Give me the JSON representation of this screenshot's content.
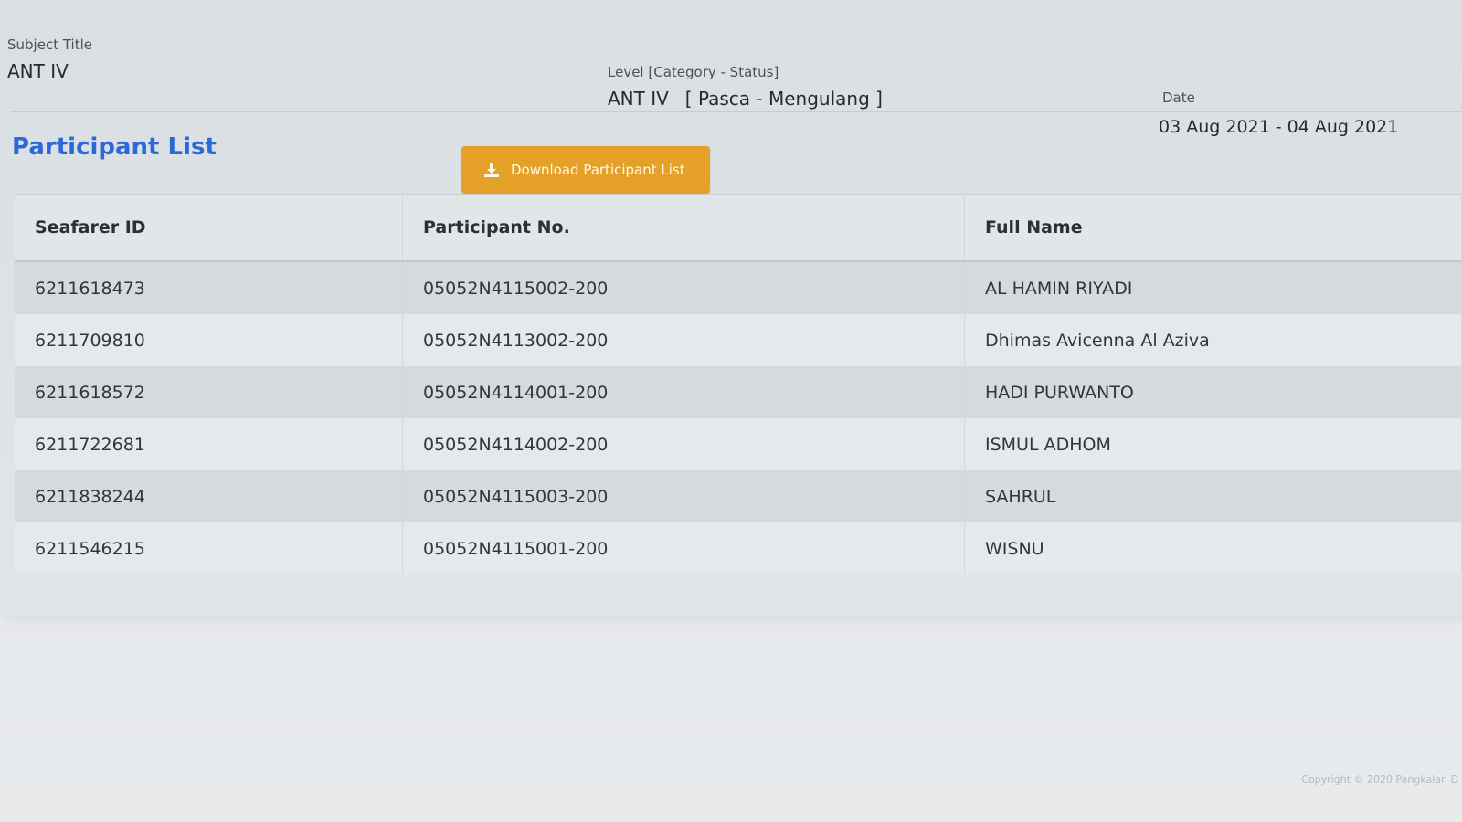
{
  "header": {
    "subject_label": "Subject Title",
    "subject_value": "ANT IV",
    "level_label": "Level [Category - Status]",
    "level_value": "ANT IV",
    "level_status": "[ Pasca - Mengulang ]",
    "date_label": "Date",
    "date_value": "03 Aug 2021 - 04 Aug 2021"
  },
  "participant_list": {
    "title": "Participant List",
    "download_label": "Download Participant List",
    "download_icon": "download-icon",
    "columns": [
      "Seafarer ID",
      "Participant No.",
      "Full Name"
    ],
    "rows": [
      {
        "seafarer_id": "6211618473",
        "participant_no": "05052N4115002-200",
        "full_name": "AL HAMIN RIYADI"
      },
      {
        "seafarer_id": "6211709810",
        "participant_no": "05052N4113002-200",
        "full_name": "Dhimas Avicenna Al Aziva"
      },
      {
        "seafarer_id": "6211618572",
        "participant_no": "05052N4114001-200",
        "full_name": "HADI PURWANTO"
      },
      {
        "seafarer_id": "6211722681",
        "participant_no": "05052N4114002-200",
        "full_name": "ISMUL ADHOM"
      },
      {
        "seafarer_id": "6211838244",
        "participant_no": "05052N4115003-200",
        "full_name": "SAHRUL"
      },
      {
        "seafarer_id": "6211546215",
        "participant_no": "05052N4115001-200",
        "full_name": "WISNU"
      }
    ]
  },
  "footer": {
    "copyright": "Copyright © 2020 Pangkalan D"
  },
  "colors": {
    "title_blue": "#2d68d8",
    "button_orange": "#e4a027"
  }
}
